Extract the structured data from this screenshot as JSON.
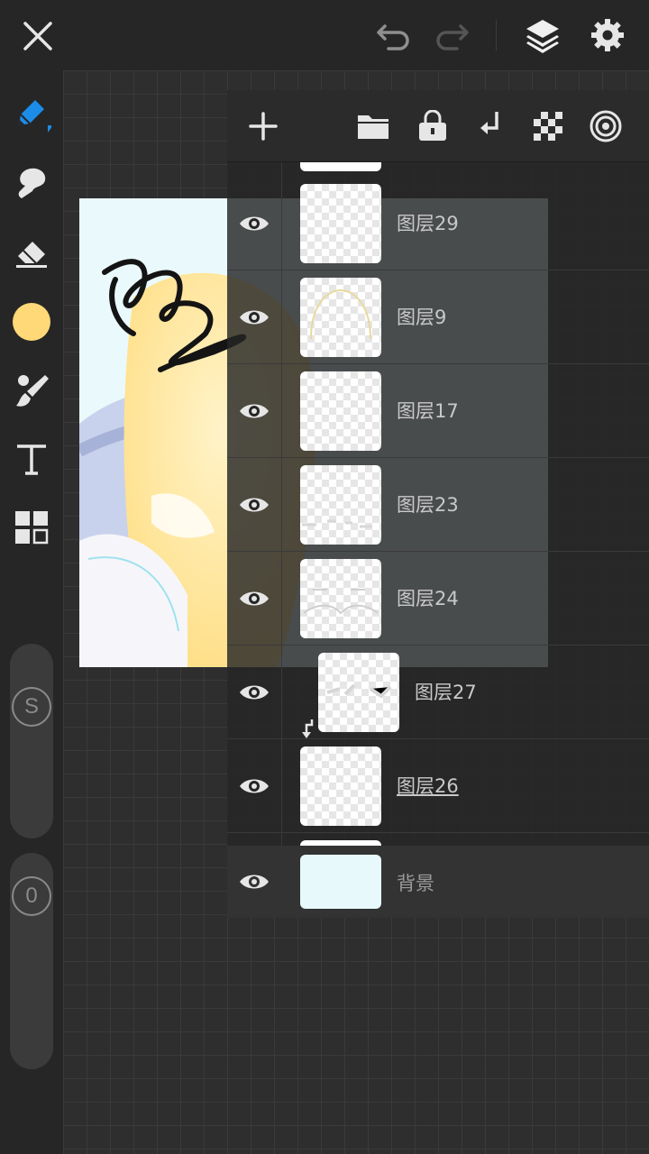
{
  "toolbar": {
    "icons": [
      "close-icon",
      "undo-icon",
      "redo-icon",
      "layers-icon",
      "settings-icon"
    ]
  },
  "tools": {
    "active_color": "#ffd878",
    "accent": "#1b8ce8",
    "icons": [
      "pen-icon",
      "smudge-icon",
      "eraser-icon",
      "color-icon",
      "brush-tool-icon",
      "text-icon",
      "material-icon"
    ]
  },
  "sliders": {
    "size_label": "S",
    "opacity_label": "0"
  },
  "layer_panel": {
    "toolbar_icons": [
      "add-layer-icon",
      "folder-icon",
      "lock-icon",
      "clip-icon",
      "transparency-lock-icon",
      "blend-icon"
    ],
    "layers": [
      {
        "name": "图层29",
        "visible": true,
        "clipped": false
      },
      {
        "name": "图层9",
        "visible": true,
        "clipped": false
      },
      {
        "name": "图层17",
        "visible": true,
        "clipped": false
      },
      {
        "name": "图层23",
        "visible": true,
        "clipped": false
      },
      {
        "name": "图层24",
        "visible": true,
        "clipped": false
      },
      {
        "name": "图层27",
        "visible": true,
        "clipped": true
      },
      {
        "name": "图层26",
        "visible": true,
        "clipped": false,
        "selected": true
      }
    ],
    "background": {
      "name": "背景",
      "color": "#e8f9fb",
      "visible": true
    }
  }
}
